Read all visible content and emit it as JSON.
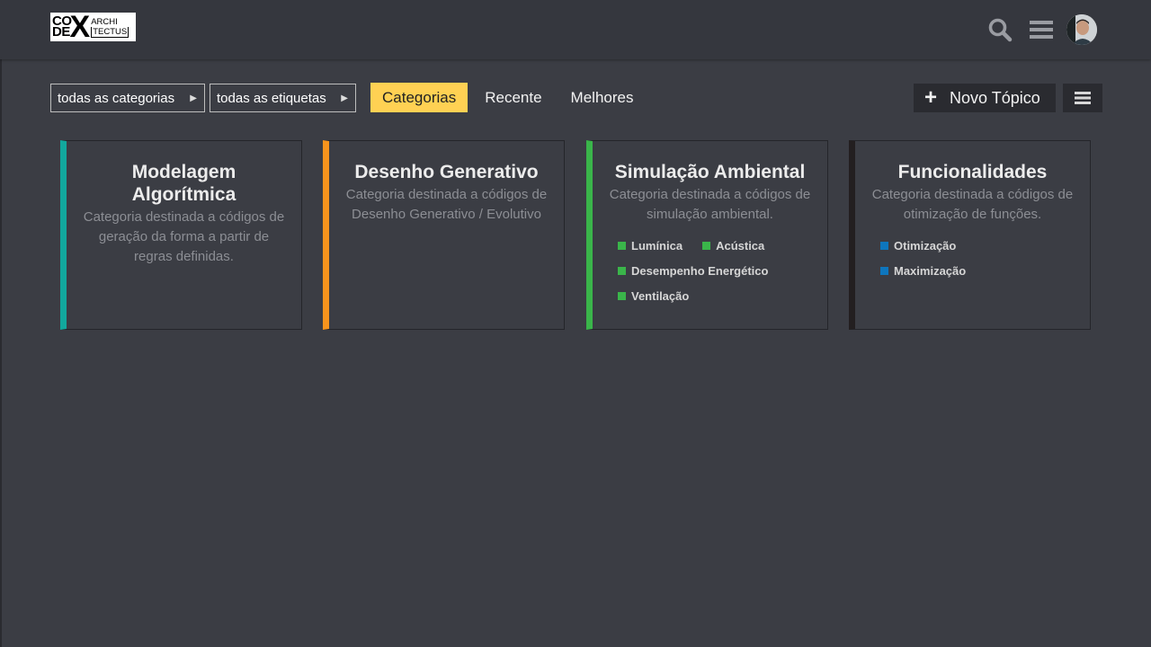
{
  "logo": {
    "line1": "CO",
    "line2": "DE",
    "x": "X",
    "word1": "ARCHI",
    "word2": "TECTUS"
  },
  "header": {
    "search_icon": "search-icon",
    "menu_icon": "hamburger-icon",
    "avatar": "user-avatar"
  },
  "nav": {
    "categories_dropdown": "todas as categorias",
    "tags_dropdown": "todas as etiquetas",
    "tabs": [
      {
        "label": "Categorias",
        "active": true
      },
      {
        "label": "Recente",
        "active": false
      },
      {
        "label": "Melhores",
        "active": false
      }
    ],
    "new_topic": "Novo Tópico"
  },
  "colors": {
    "accent_yellow": "#ffd153",
    "teal": "#12a89d",
    "orange": "#f7941d",
    "green": "#3ab54a",
    "dark": "#231f20",
    "blue": "#0e76bd"
  },
  "categories": [
    {
      "title": "Modelagem Algorítmica",
      "color": "#12a89d",
      "description": "Categoria destinada a códigos de geração da forma a partir de regras definidas.",
      "subcategories": []
    },
    {
      "title": "Desenho Generativo",
      "color": "#f7941d",
      "description": "Categoria destinada a códigos de Desenho Generativo / Evolutivo",
      "subcategories": []
    },
    {
      "title": "Simulação Ambiental",
      "color": "#3ab54a",
      "description": "Categoria destinada a códigos de simulação ambiental.",
      "subcategories": [
        {
          "name": "Lumínica",
          "color": "#3ab54a"
        },
        {
          "name": "Acústica",
          "color": "#3ab54a"
        },
        {
          "name": "Desempenho Energético",
          "color": "#3ab54a"
        },
        {
          "name": "Ventilação",
          "color": "#3ab54a"
        }
      ]
    },
    {
      "title": "Funcionalidades",
      "color": "#231f20",
      "description": "Categoria destinada a códigos de otimização de funções.",
      "subcategories": [
        {
          "name": "Otimização",
          "color": "#0e76bd"
        },
        {
          "name": "Maximização",
          "color": "#0e76bd"
        }
      ]
    }
  ]
}
